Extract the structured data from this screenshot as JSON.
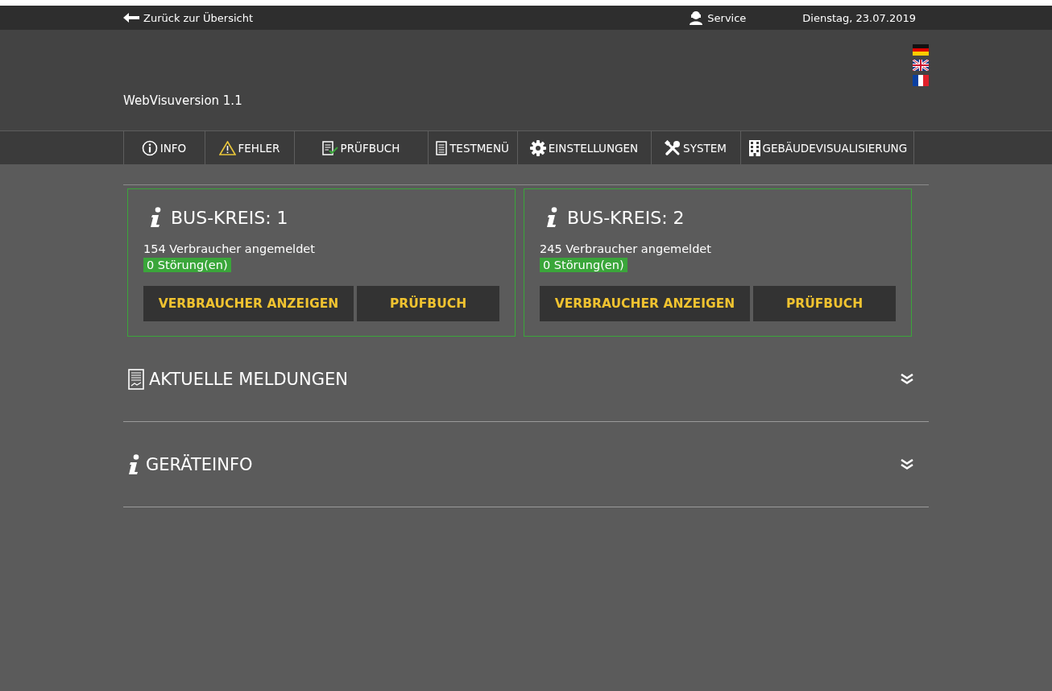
{
  "topbar": {
    "back_link": "Zurück zur Übersicht",
    "service": "Service",
    "date": "Dienstag, 23.07.2019"
  },
  "header": {
    "version": "WebVisuversion 1.1",
    "languages": [
      {
        "kind": "de"
      },
      {
        "kind": "en"
      },
      {
        "kind": "fr"
      }
    ]
  },
  "nav": [
    {
      "label": "INFO",
      "kind": "info"
    },
    {
      "label": "FEHLER",
      "kind": "warning"
    },
    {
      "label": "PRÜFBUCH",
      "kind": "checkbook"
    },
    {
      "label": "TESTMENÜ",
      "kind": "document"
    },
    {
      "label": "EINSTELLUNGEN",
      "kind": "gear"
    },
    {
      "label": "SYSTEM",
      "kind": "tools"
    },
    {
      "label": "GEBÄUDEVISUALISIERUNG",
      "kind": "building"
    }
  ],
  "bus_circuits": [
    {
      "title": "BUS-KREIS: 1",
      "consumers": "154 Verbraucher angemeldet",
      "faults": "0 Störung(en)",
      "faulty": false,
      "buttons": [
        "VERBRAUCHER ANZEIGEN",
        "PRÜFBUCH"
      ]
    },
    {
      "title": "BUS-KREIS: 2",
      "consumers": "245 Verbraucher angemeldet",
      "faults": "0 Störung(en)",
      "faulty": false,
      "buttons": [
        "VERBRAUCHER ANZEIGEN",
        "PRÜFBUCH"
      ]
    }
  ],
  "sections": [
    {
      "title": "AKTUELLE MELDUNGEN",
      "kind": "report",
      "expanded": false
    },
    {
      "title": "GERÄTEINFO",
      "kind": "info",
      "expanded": false
    }
  ]
}
